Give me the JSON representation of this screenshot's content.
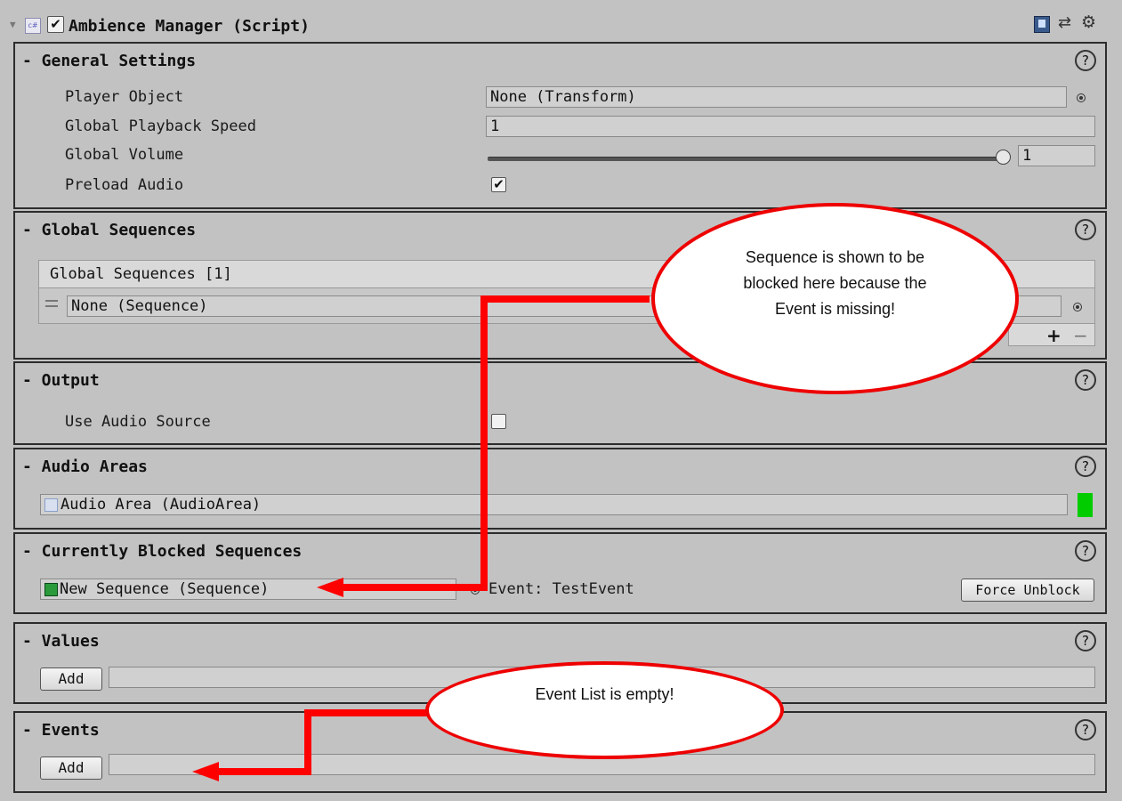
{
  "component": {
    "title": "Ambience Manager (Script)",
    "enabled_check": "✔",
    "cs_icon": "c#",
    "icons": [
      "collapse-arrow-icon",
      "cs-script-icon",
      "book-icon",
      "preset-icon",
      "gear-icon"
    ]
  },
  "general_settings": {
    "title": "- General Settings",
    "player_object_label": "Player Object",
    "player_object_value": "None (Transform)",
    "playback_speed_label": "Global Playback Speed",
    "playback_speed_value": "1",
    "volume_label": "Global Volume",
    "volume_value": "1",
    "volume_slider_fraction": 1.0,
    "preload_label": "Preload Audio",
    "preload_checked": "✔"
  },
  "global_sequences": {
    "title": "- Global Sequences",
    "list_header": "Global Sequences [1]",
    "items": [
      "None (Sequence)"
    ],
    "add_label": "+",
    "remove_label": "−"
  },
  "output": {
    "title": "- Output",
    "use_audio_source_label": "Use Audio Source",
    "use_audio_source_checked": ""
  },
  "audio_areas": {
    "title": "- Audio Areas",
    "area_value": "Audio Area (AudioArea)",
    "status_color": "#00cc00"
  },
  "blocked_sequences": {
    "title": "- Currently Blocked Sequences",
    "sequence_value": "New Sequence (Sequence)",
    "event_text": "Event: TestEvent",
    "force_unblock_label": "Force Unblock"
  },
  "values": {
    "title": "- Values",
    "add_label": "Add"
  },
  "events": {
    "title": "- Events",
    "add_label": "Add"
  },
  "help_glyph": "?",
  "annotations": {
    "callout_blocked": "Sequence is shown to be blocked here because the Event is missing!",
    "callout_empty": "Event List is empty!",
    "color": "#ff0000"
  }
}
